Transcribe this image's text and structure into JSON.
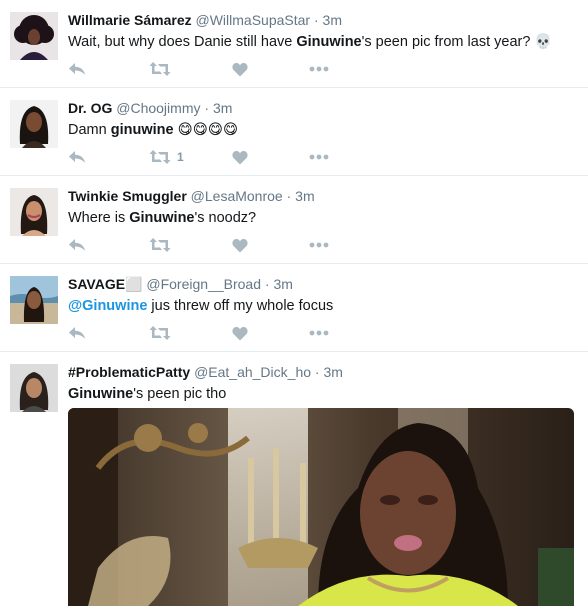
{
  "tweets": [
    {
      "name": "Willmarie Sámarez",
      "handle": "@WillmaSupaStar",
      "time": "3m",
      "text_parts": [
        "Wait, but why does Danie still have ",
        "Ginuwine",
        "'s peen pic from last year? 💀"
      ],
      "retweet_count": ""
    },
    {
      "name": "Dr. OG",
      "handle": "@Choojimmy",
      "time": "3m",
      "text_parts": [
        "Damn ",
        "ginuwine",
        " 😋😋😋😋"
      ],
      "retweet_count": "1"
    },
    {
      "name": "Twinkie Smuggler",
      "handle": "@LesaMonroe",
      "time": "3m",
      "text_parts": [
        "Where is ",
        "Ginuwine",
        "'s noodz?"
      ],
      "retweet_count": ""
    },
    {
      "name": "SAVAGE⬜",
      "handle": "@Foreign__Broad",
      "time": "3m",
      "text_parts": [
        "@Ginuwine",
        " jus threw off my whole focus"
      ],
      "retweet_count": ""
    },
    {
      "name": "#ProblematicPatty",
      "handle": "@Eat_ah_Dick_ho",
      "time": "3m",
      "text_parts": [
        "Ginuwine",
        "'s peen pic tho"
      ],
      "retweet_count": ""
    }
  ],
  "icons": {
    "reply": "reply-icon",
    "retweet": "retweet-icon",
    "like": "heart-icon",
    "more": "more-icon"
  },
  "colors": {
    "name": "#14171a",
    "secondary": "#657786",
    "mention": "#1b95e0",
    "action": "#aab8c2",
    "divider": "#e6ecf0"
  }
}
